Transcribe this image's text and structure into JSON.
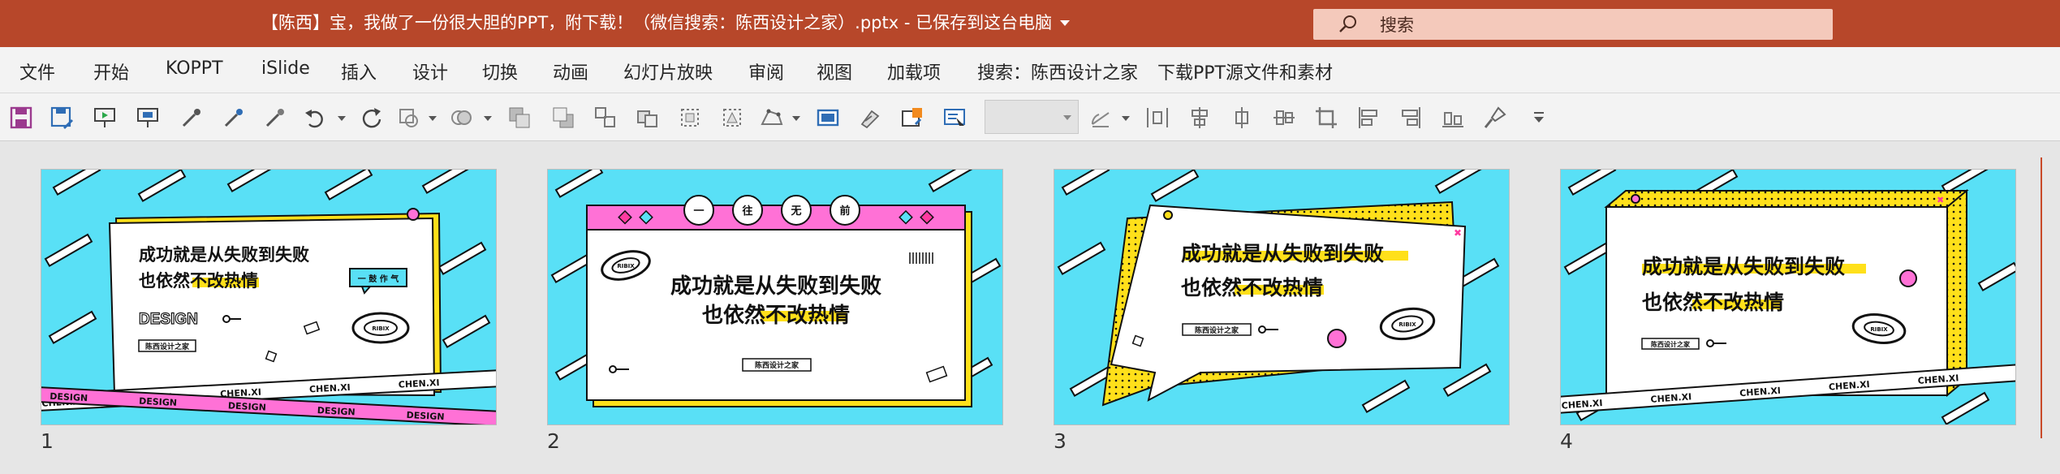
{
  "title_bar": {
    "document_title": "【陈西】宝，我做了一份很大胆的PPT，附下载！（微信搜索：陈西设计之家）.pptx  -  已保存到这台电脑",
    "search_placeholder": "搜索",
    "colors": {
      "accent": "#b7472a",
      "search_bg": "#f4c9bb"
    }
  },
  "menu": {
    "items": [
      "文件",
      "开始",
      "KOPPT",
      "iSlide",
      "插入",
      "设计",
      "切换",
      "动画",
      "幻灯片放映",
      "审阅",
      "视图",
      "加载项",
      "搜索：陈西设计之家",
      "下载PPT源文件和素材"
    ]
  },
  "toolbar": {
    "icons": [
      "save-icon",
      "save-as-icon",
      "present-from-start-icon",
      "present-current-icon",
      "eyedropper-icon",
      "eyedropper-line-icon",
      "eyedropper-fill-icon",
      "undo-icon",
      "redo-icon",
      "shape-outline-icon",
      "shape-fill-icon",
      "bring-forward-icon",
      "send-backward-icon",
      "group-icon",
      "ungroup-icon",
      "select-icon",
      "crop-shape-icon",
      "edit-points-icon",
      "align-frame-icon",
      "format-painter-icon",
      "picture-icon",
      "text-select-icon",
      "font-size-combo",
      "rotate-icon",
      "distribute-horizontal-icon",
      "align-center-icon",
      "distribute-vertical-icon",
      "align-middle-icon",
      "crop-icon",
      "align-left-icon",
      "align-right-icon",
      "align-bottom-icon",
      "format-brush-icon",
      "customize-toolbar-icon"
    ]
  },
  "slides": [
    {
      "number": "1",
      "line1": "成功就是从失败到失败",
      "line2_pre": "也依然",
      "line2_hl": "不改热情",
      "outline": "DESIGN",
      "tag": "陈西设计之家",
      "badge": "一 鼓 作 气",
      "tape": "CHEN.XI",
      "tape2": "DESIGN",
      "ring": "RIBIX"
    },
    {
      "number": "2",
      "line1": "成功就是从失败到失败",
      "line2_pre": "也依然",
      "line2_hl": "不改热情",
      "tag": "陈西设计之家",
      "bubbles": [
        "一",
        "往",
        "无",
        "前"
      ],
      "ring": "RIBIX"
    },
    {
      "number": "3",
      "line1": "成功就是从失败到失败",
      "line2_pre": "也依然",
      "line2_hl": "不改热情",
      "tag": "陈西设计之家",
      "ring": "RIBIX"
    },
    {
      "number": "4",
      "line1": "成功就是从失败到失败",
      "line2_pre": "也依然",
      "line2_hl": "不改热情",
      "tag": "陈西设计之家",
      "tape": "CHEN.XI",
      "ring": "RIBIX"
    }
  ],
  "palette": {
    "cyan": "#59e0f6",
    "yellow": "#ffe01a",
    "pink": "#ff71d6",
    "black": "#111111",
    "white": "#ffffff"
  }
}
